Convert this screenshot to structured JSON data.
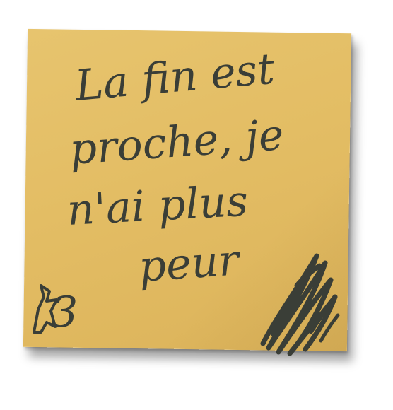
{
  "note": {
    "lines": [
      "La fin est",
      "proche, je",
      "n'ai plus",
      "peur"
    ],
    "corner_mark": "3",
    "paper_color": "#e3bd64",
    "ink_color": "#3a3e37"
  }
}
